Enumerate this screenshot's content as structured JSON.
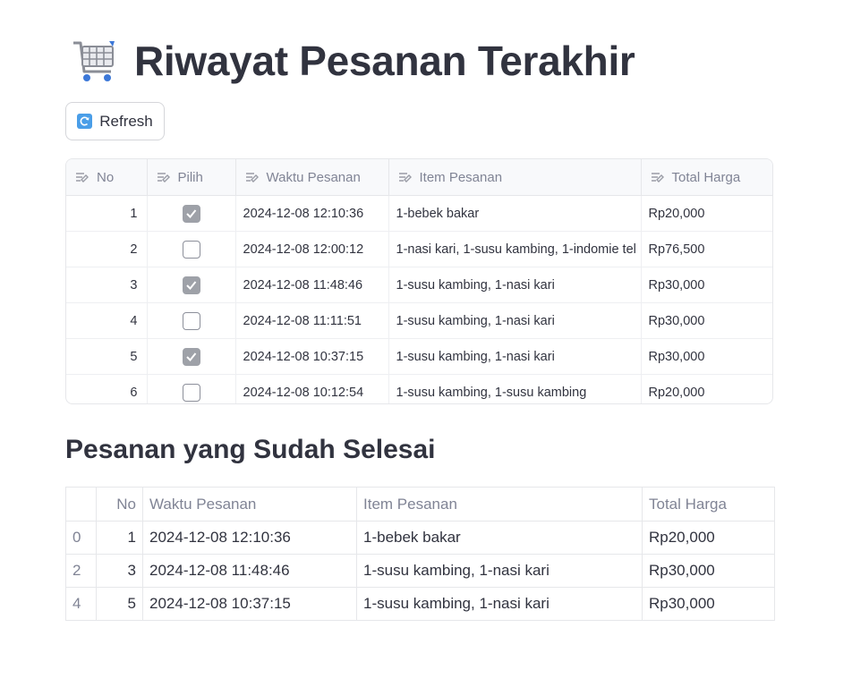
{
  "title": "Riwayat Pesanan Terakhir",
  "refresh_label": "Refresh",
  "editor": {
    "columns": [
      "No",
      "Pilih",
      "Waktu Pesanan",
      "Item Pesanan",
      "Total Harga"
    ],
    "rows": [
      {
        "no": "1",
        "pilih": true,
        "waktu": "2024-12-08 12:10:36",
        "item": "1-bebek bakar",
        "total": "Rp20,000"
      },
      {
        "no": "2",
        "pilih": false,
        "waktu": "2024-12-08 12:00:12",
        "item": "1-nasi kari, 1-susu kambing, 1-indomie tel",
        "total": "Rp76,500"
      },
      {
        "no": "3",
        "pilih": true,
        "waktu": "2024-12-08 11:48:46",
        "item": "1-susu kambing, 1-nasi kari",
        "total": "Rp30,000"
      },
      {
        "no": "4",
        "pilih": false,
        "waktu": "2024-12-08 11:11:51",
        "item": "1-susu kambing, 1-nasi kari",
        "total": "Rp30,000"
      },
      {
        "no": "5",
        "pilih": true,
        "waktu": "2024-12-08 10:37:15",
        "item": "1-susu kambing, 1-nasi kari",
        "total": "Rp30,000"
      },
      {
        "no": "6",
        "pilih": false,
        "waktu": "2024-12-08 10:12:54",
        "item": "1-susu kambing, 1-susu kambing",
        "total": "Rp20,000"
      }
    ]
  },
  "completed": {
    "title": "Pesanan yang Sudah Selesai",
    "columns": [
      "",
      "No",
      "Waktu Pesanan",
      "Item Pesanan",
      "Total Harga"
    ],
    "rows": [
      {
        "index": "0",
        "no": "1",
        "waktu": "2024-12-08 12:10:36",
        "item": "1-bebek bakar",
        "total": "Rp20,000"
      },
      {
        "index": "2",
        "no": "3",
        "waktu": "2024-12-08 11:48:46",
        "item": "1-susu kambing, 1-nasi kari",
        "total": "Rp30,000"
      },
      {
        "index": "4",
        "no": "5",
        "waktu": "2024-12-08 10:37:15",
        "item": "1-susu kambing, 1-nasi kari",
        "total": "Rp30,000"
      }
    ]
  },
  "icons": {
    "title": "shopping-cart-icon",
    "refresh": "refresh-icon",
    "column": "edit-column-icon"
  },
  "colors": {
    "text": "#31333f",
    "muted": "#808495",
    "checkbox_checked": "#9ea1a8",
    "refresh_icon": "#4a9ee8"
  }
}
